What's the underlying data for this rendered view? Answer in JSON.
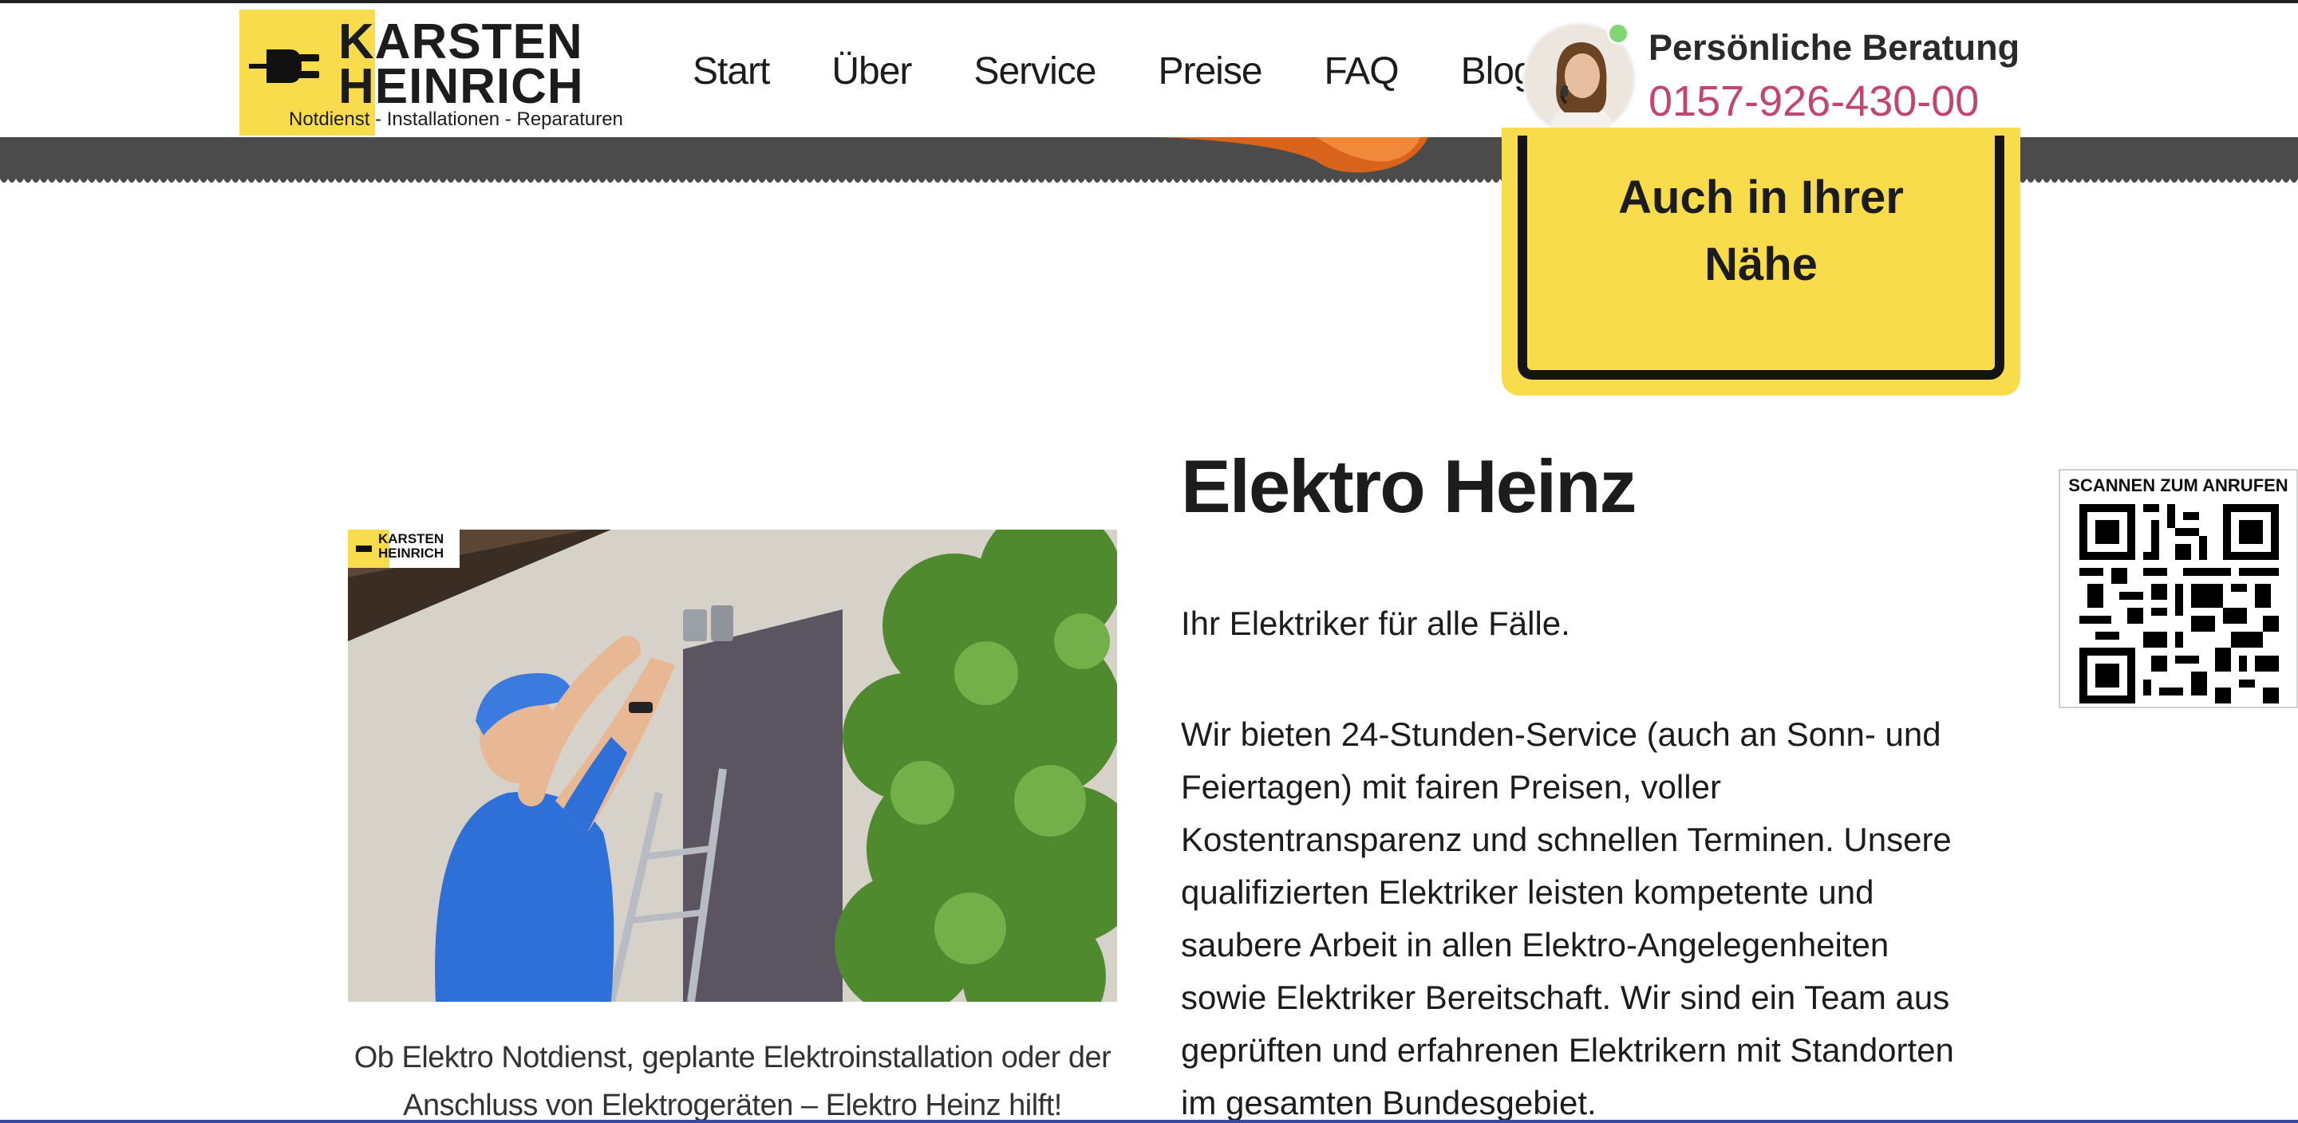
{
  "brand": {
    "line1": "KARSTEN",
    "line2": "HEINRICH",
    "tagline": "Notdienst - Installationen - Reparaturen",
    "accent_color": "#f8dc4c"
  },
  "nav": {
    "items": [
      {
        "label": "Start"
      },
      {
        "label": "Über"
      },
      {
        "label": "Service"
      },
      {
        "label": "Preise"
      },
      {
        "label": "FAQ"
      },
      {
        "label": "Blog"
      }
    ]
  },
  "consult": {
    "title": "Persönliche Beratung",
    "phone": "0157-926-430-00",
    "phone_color": "#c3446e",
    "status_color": "#7fd672"
  },
  "badge": {
    "line1": "Auch in Ihrer",
    "line2": "Nähe"
  },
  "qr": {
    "label": "SCANNEN ZUM ANRUFEN"
  },
  "main": {
    "title": "Elektro Heinz",
    "lead": "Ihr Elektriker für alle Fälle.",
    "body": "Wir bieten 24-Stunden-Service (auch an Sonn- und Feiertagen) mit fairen Preisen, voller Kostentransparenz und schnellen Terminen. Unsere qualifizierten Elektriker leisten kompetente und saubere Arbeit in allen Elektro-Angelegenheiten sowie Elektriker Bereitschaft. Wir sind ein Team aus geprüften und erfahrenen Elektrikern mit Standorten im gesamten Bundesgebiet.",
    "image_caption": "Ob Elektro Notdienst, geplante Elektroinstallation oder der Anschluss von Elektrogeräten – Elektro Heinz hilft!"
  },
  "image_watermark": {
    "line1": "KARSTEN",
    "line2": "HEINRICH"
  }
}
